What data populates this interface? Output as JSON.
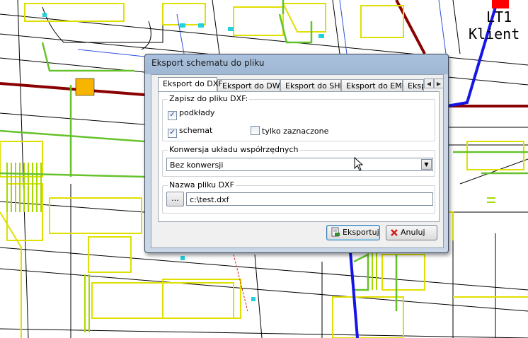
{
  "background_map": {
    "label_line1": "LT1",
    "label_line2": "Klient"
  },
  "dialog": {
    "title": "Eksport schematu do pliku",
    "tabs": [
      "Eksport do DXF",
      "Eksport do DWG",
      "Eksport do SHP",
      "Eksport do EMF",
      "Eksp"
    ],
    "active_tab": "Eksport do DXF",
    "save_group": {
      "title": "Zapisz do pliku DXF:",
      "checkboxes": [
        {
          "label": "podkłady",
          "checked": true
        },
        {
          "label": "schemat",
          "checked": true
        },
        {
          "label": "tylko zaznaczone",
          "checked": false
        }
      ]
    },
    "conversion_group": {
      "title": "Konwersja układu współrzędnych",
      "selected": "Bez konwersji"
    },
    "filename_group": {
      "title": "Nazwa pliku DXF",
      "browse_label": "...",
      "value": "c:\\test.dxf"
    },
    "buttons": {
      "export_label": "Eksportuj",
      "cancel_label": "Anuluj"
    }
  },
  "colors": {
    "map_yellow": "#e8e800",
    "map_green": "#77cc33",
    "map_blue": "#1515e8",
    "map_darkred": "#8b0000",
    "orange_marker": "#f7b500",
    "red_marker": "#ff0000"
  }
}
